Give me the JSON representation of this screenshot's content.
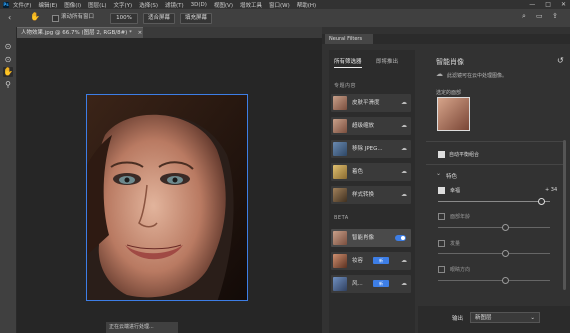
{
  "menubar": {
    "app_icon": "Ps",
    "items": [
      "文件(F)",
      "编辑(E)",
      "图像(I)",
      "图层(L)",
      "文字(Y)",
      "选择(S)",
      "滤镜(T)",
      "3D(D)",
      "视图(V)",
      "增效工具",
      "窗口(W)",
      "帮助(H)"
    ],
    "window_controls": [
      "—",
      "□",
      "✕"
    ]
  },
  "options": {
    "scroll_all_label": "滚动所有窗口",
    "zoom_value": "100%",
    "fit_screen_label": "适合屏幕",
    "fill_screen_label": "填充屏幕"
  },
  "document": {
    "tab_title": "人物效果.jpg @ 66.7% (图层 2, RGB/8#) *",
    "close": "×",
    "status": "正在云端进行处理..."
  },
  "neural_filters": {
    "tab_label": "Neural Filters",
    "tabs": {
      "all": "所有筛选器",
      "waitlist": "即将推出"
    },
    "categories": {
      "portraits": "专题内容",
      "beta": "BETA"
    },
    "portrait_items": [
      {
        "label": "皮肤平滑度"
      },
      {
        "label": "超级缩放"
      },
      {
        "label": "移除 JPEG..."
      },
      {
        "label": "着色"
      },
      {
        "label": "样式转换"
      }
    ],
    "beta_items": [
      {
        "label": "智能肖像",
        "active": true
      },
      {
        "label": "妆容",
        "badge": "新"
      },
      {
        "label": "风...",
        "badge": "新"
      }
    ]
  },
  "detail": {
    "title": "智能肖像",
    "description": "此滤镜可在云中处理图像。",
    "selected_face_label": "选定的面部",
    "auto_balance_label": "自动平衡组合",
    "section_label": "特色",
    "sliders": [
      {
        "label": "幸福",
        "value_text": "+ 34",
        "value": 34,
        "checked": true
      },
      {
        "label": "面部年龄",
        "value_text": "",
        "value": 0,
        "checked": false
      },
      {
        "label": "发量",
        "value_text": "",
        "value": 0,
        "checked": false
      },
      {
        "label": "眼睛方向",
        "value_text": "",
        "value": 0,
        "checked": false
      }
    ],
    "output_label": "输出",
    "output_value": "新图层"
  },
  "colors": {
    "accent": "#3d7ee6",
    "panel": "#323232",
    "canvas": "#262626"
  }
}
